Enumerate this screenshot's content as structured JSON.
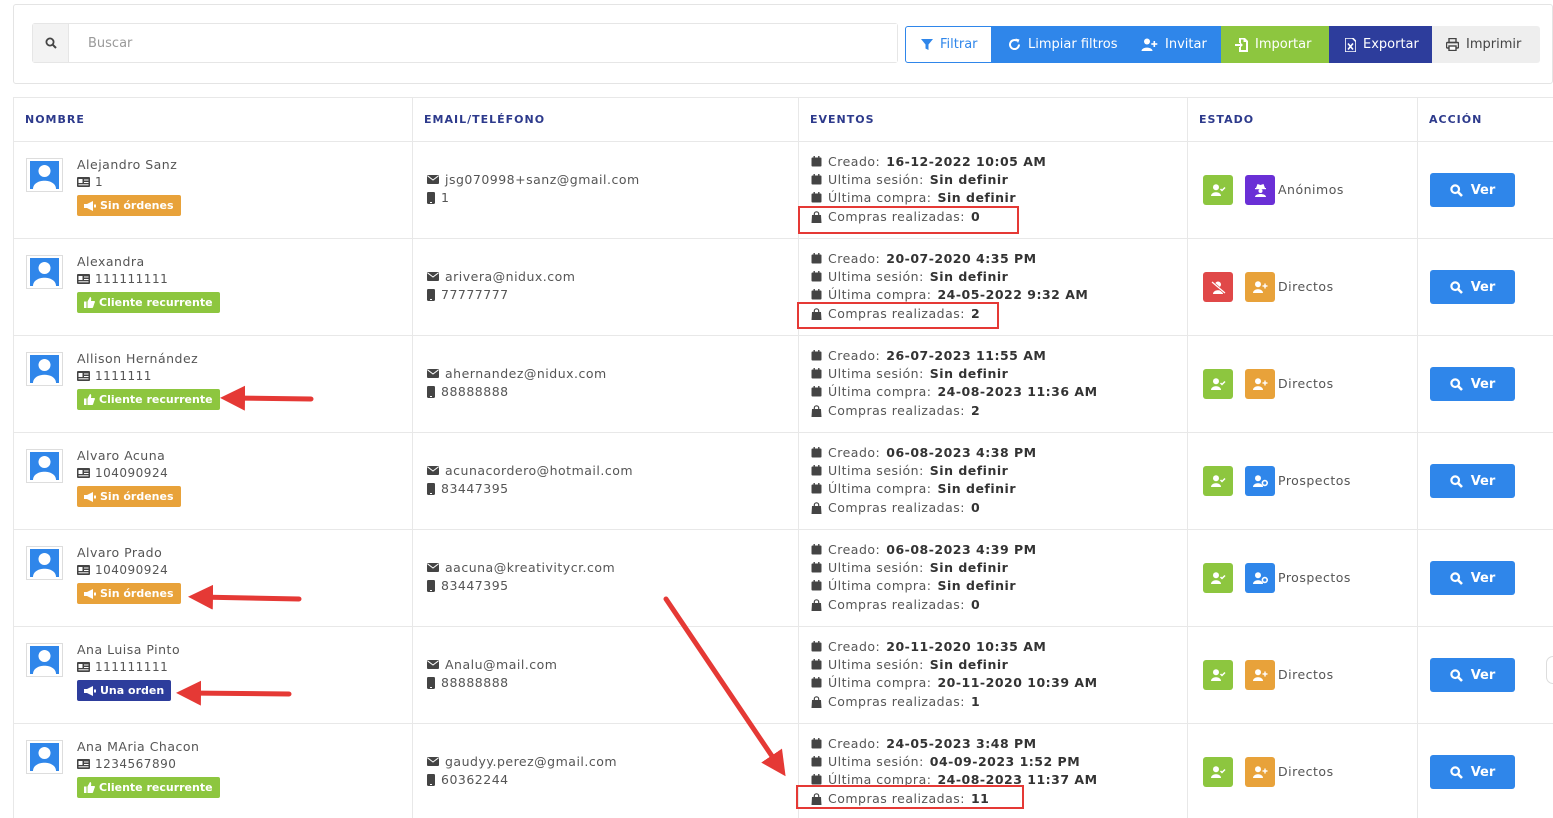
{
  "search": {
    "placeholder": "Buscar",
    "value": ""
  },
  "toolbar": {
    "filter_label": "Filtrar",
    "clear_label": "Limpiar filtros",
    "invite_label": "Invitar",
    "import_label": "Importar",
    "export_label": "Exportar",
    "print_label": "Imprimir"
  },
  "columns": {
    "name": "NOMBRE",
    "contact": "EMAIL/TELÉFONO",
    "events": "EVENTOS",
    "status": "ESTADO",
    "action": "ACCIÓN"
  },
  "labels": {
    "created": "Creado:",
    "last_session_a": "Ultima sesión:",
    "last_purchase": "Última compra:",
    "purchases": "Compras realizadas:",
    "view": "Ver"
  },
  "rows": [
    {
      "name": "Alejandro Sanz",
      "id": "1",
      "badge": "Sin órdenes",
      "email": "jsg070998+sanz@gmail.com",
      "phone": "1",
      "created": "16-12-2022 10:05 AM",
      "last_session": "Sin definir",
      "last_purchase": "Sin definir",
      "purchases": "0",
      "segment": "Anónimos"
    },
    {
      "name": "Alexandra",
      "id": "111111111",
      "badge": "Cliente recurrente",
      "email": "arivera@nidux.com",
      "phone": "77777777",
      "created": "20-07-2020 4:35 PM",
      "last_session": "Sin definir",
      "last_purchase": "24-05-2022 9:32 AM",
      "purchases": "2",
      "segment": "Directos"
    },
    {
      "name": "Allison Hernández",
      "id": "1111111",
      "badge": "Cliente recurrente",
      "email": "ahernandez@nidux.com",
      "phone": "88888888",
      "created": "26-07-2023 11:55 AM",
      "last_session": "Sin definir",
      "last_purchase": "24-08-2023 11:36 AM",
      "purchases": "2",
      "segment": "Directos"
    },
    {
      "name": "Alvaro Acuna",
      "id": "104090924",
      "badge": "Sin órdenes",
      "email": "acunacordero@hotmail.com",
      "phone": "83447395",
      "created": "06-08-2023 4:38 PM",
      "last_session": "Sin definir",
      "last_purchase": "Sin definir",
      "purchases": "0",
      "segment": "Prospectos"
    },
    {
      "name": "Alvaro Prado",
      "id": "104090924",
      "badge": "Sin órdenes",
      "email": "aacuna@kreativitycr.com",
      "phone": "83447395",
      "created": "06-08-2023 4:39 PM",
      "last_session": "Sin definir",
      "last_purchase": "Sin definir",
      "purchases": "0",
      "segment": "Prospectos"
    },
    {
      "name": "Ana Luisa Pinto",
      "id": "111111111",
      "badge": "Una orden",
      "email": "Analu@mail.com",
      "phone": "88888888",
      "created": "20-11-2020 10:35 AM",
      "last_session": "Sin definir",
      "last_purchase": "20-11-2020 10:39 AM",
      "purchases": "1",
      "segment": "Directos"
    },
    {
      "name": "Ana MAria Chacon",
      "id": "1234567890",
      "badge": "Cliente recurrente",
      "email": "gaudyy.perez@gmail.com",
      "phone": "60362244",
      "created": "24-05-2023 3:48 PM",
      "last_session": "04-09-2023 1:52 PM",
      "last_purchase": "24-08-2023 11:37 AM",
      "purchases": "11",
      "segment": "Directos"
    }
  ],
  "colors": {
    "primary": "#2f86ea",
    "success": "#8dc63f",
    "navy": "#2d3d9c",
    "warning": "#e8a23a",
    "danger": "#e04848",
    "purple": "#6a2fd6",
    "annotation": "#e53935"
  }
}
